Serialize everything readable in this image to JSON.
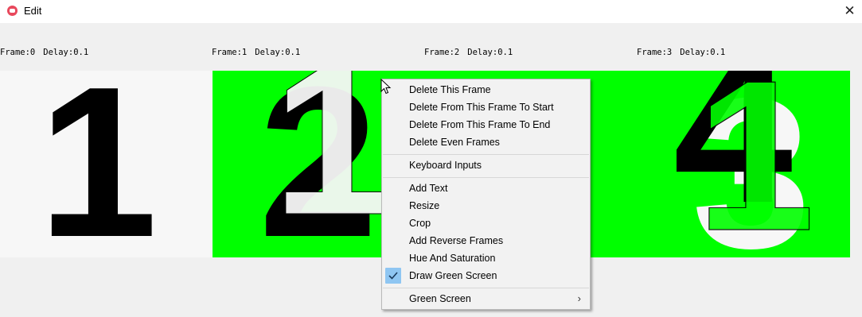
{
  "window": {
    "title": "Edit",
    "close_glyph": "✕",
    "app_icon": "app-logo-icon"
  },
  "frames": [
    {
      "label": "Frame:0",
      "delay": "Delay:0.1",
      "digit": "1"
    },
    {
      "label": "Frame:1",
      "delay": "Delay:0.1",
      "digits": [
        "2",
        "1"
      ]
    },
    {
      "label": "Frame:2",
      "delay": "Delay:0.1"
    },
    {
      "label": "Frame:3",
      "delay": "Delay:0.1",
      "digits": [
        "4",
        "3",
        "1"
      ]
    }
  ],
  "colors": {
    "green_screen": "#00ff00",
    "frame_bg": "#f7f7f7",
    "ink": "#000000",
    "check_highlight": "#8fc6f2"
  },
  "context_menu": {
    "groups": [
      [
        "Delete This Frame",
        "Delete From This Frame To Start",
        "Delete From This Frame To End",
        "Delete Even Frames"
      ],
      [
        "Keyboard Inputs"
      ],
      [
        "Add Text",
        "Resize",
        "Crop",
        "Add Reverse Frames",
        "Hue And Saturation",
        "Draw Green Screen"
      ],
      [
        "Green Screen"
      ]
    ],
    "checked_item": "Draw Green Screen",
    "submenu_item": "Green Screen",
    "check_icon": "check-icon",
    "submenu_glyph": "›"
  }
}
